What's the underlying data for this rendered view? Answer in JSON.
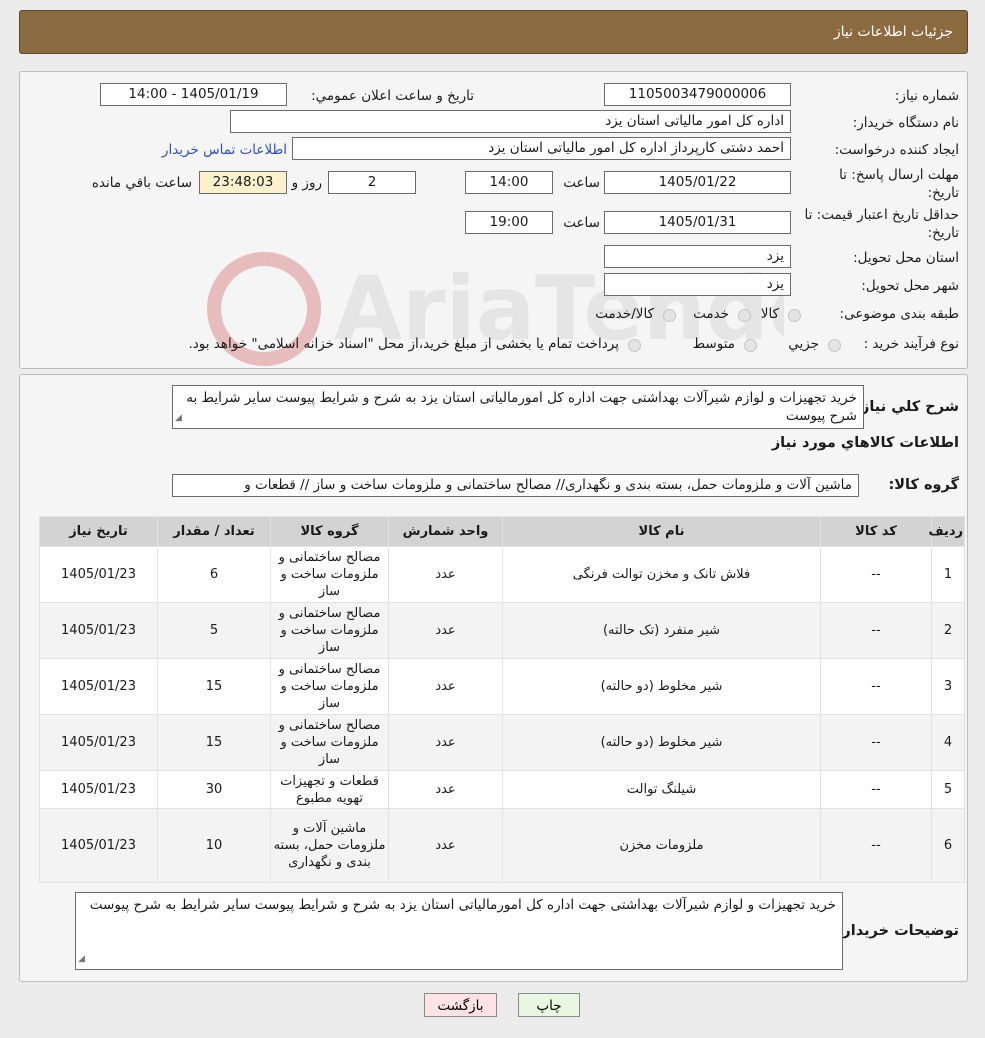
{
  "header": {
    "title": "جزئیات اطلاعات نیاز"
  },
  "form": {
    "need_number_label": "شماره نیاز:",
    "need_number": "1105003479000006",
    "announce_label": "تاریخ و ساعت اعلان عمومي:",
    "announce_value": "1405/01/19 - 14:00",
    "buyer_org_label": "نام دستگاه خريدار:",
    "buyer_org": "اداره کل امور مالياتی استان یزد",
    "requester_label": "ايجاد کننده درخواست:",
    "requester": "احمد دشتی کارپرداز اداره کل امور مالیاتی استان یزد",
    "contact_link": "اطلاعات تماس خريدار",
    "reply_deadline_label": "مهلت ارسال پاسخ: تا تاريخ:",
    "reply_date": "1405/01/22",
    "time_label": "ساعت",
    "reply_time": "14:00",
    "days_value": "2",
    "days_label": "روز و",
    "remaining_value": "23:48:03",
    "remaining_label": "ساعت باقي مانده",
    "price_validity_label": "حداقل تاريخ اعتبار قيمت: تا تاريخ:",
    "validity_date": "1405/01/31",
    "validity_time": "19:00",
    "province_label": "استان محل تحويل:",
    "province": "یزد",
    "city_label": "شهر محل تحويل:",
    "city": "یزد",
    "category_label": "طبقه بندی موضوعی:",
    "category_options": [
      "کالا",
      "خدمت",
      "کالا/خدمت"
    ],
    "process_label": "نوع فرآيند خريد :",
    "process_options": [
      "جزيي",
      "متوسط"
    ],
    "payment_note": "پرداخت تمام يا بخشی از مبلغ خريد،از محل \"اسناد خزانه اسلامی\" خواهد بود."
  },
  "details": {
    "description_label": "شرح کلي نياز:",
    "description": "خرید تجهیزات و لوازم شیرآلات بهداشتی جهت اداره کل امورمالیاتی استان یزد به شرح و شرایط پیوست سایر شرایط به شرح پیوست",
    "goods_info_title": "اطلاعات کالاهاي مورد نياز",
    "goods_group_label": "گروه کالا:",
    "goods_group": "ماشین آلات و ملزومات حمل، بسته بندی و نگهداری// مصالح ساختمانی و ملزومات ساخت و ساز //  قطعات و",
    "table": {
      "headers": [
        "رديف",
        "کد کالا",
        "نام کالا",
        "واحد شمارش",
        "گروه کالا",
        "تعداد / مقدار",
        "تاریخ نیاز"
      ],
      "rows": [
        [
          "1",
          "--",
          "فلاش تانک و مخزن توالت فرنگی",
          "عدد",
          "مصالح ساختمانی و ملزومات ساخت و ساز",
          "6",
          "1405/01/23"
        ],
        [
          "2",
          "--",
          "شیر منفرد (تک حالته)",
          "عدد",
          "مصالح ساختمانی و ملزومات ساخت و ساز",
          "5",
          "1405/01/23"
        ],
        [
          "3",
          "--",
          "شیر مخلوط (دو حالته)",
          "عدد",
          "مصالح ساختمانی و ملزومات ساخت و ساز",
          "15",
          "1405/01/23"
        ],
        [
          "4",
          "--",
          "شیر مخلوط (دو حالته)",
          "عدد",
          "مصالح ساختمانی و ملزومات ساخت و ساز",
          "15",
          "1405/01/23"
        ],
        [
          "5",
          "--",
          "شیلنگ توالت",
          "عدد",
          "قطعات و تجهیزات تهویه مطبوع",
          "30",
          "1405/01/23"
        ],
        [
          "6",
          "--",
          "ملزومات مخزن",
          "عدد",
          "ماشین آلات و ملزومات حمل، بسته بندی و نگهداری",
          "10",
          "1405/01/23"
        ]
      ]
    },
    "buyer_notes_label": "توضيحات خريدار:",
    "buyer_notes": "خرید تجهیزات و لوازم شیرآلات بهداشتی جهت اداره کل امورمالیاتی استان یزد به شرح و شرایط پیوست سایر شرایط به شرح پیوست"
  },
  "buttons": {
    "print": "چاپ",
    "back": "بازگشت"
  },
  "watermark": "AriaTender.neT",
  "colors": {
    "header": "#8a6a3e",
    "link": "#2b4fc2",
    "back_button": "#fde3e3",
    "print_button": "#e8f7e2",
    "timer_box": "#fbf1cf"
  }
}
